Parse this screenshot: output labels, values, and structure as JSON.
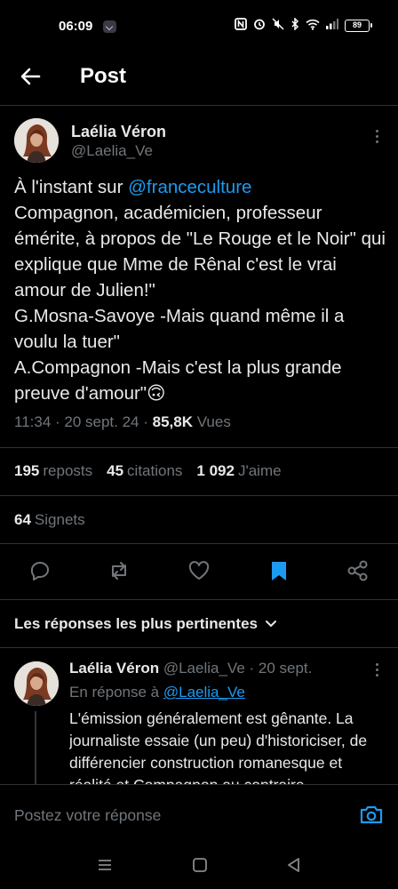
{
  "status_bar": {
    "time": "06:09",
    "battery": "89"
  },
  "header": {
    "title": "Post"
  },
  "tweet": {
    "author_name": "Laélia Véron",
    "author_handle": "@Laelia_Ve",
    "text_prefix": "À l'instant sur ",
    "mention": "@franceculture",
    "text_body": "Compagnon, académicien, professeur émérite, à propos de \"Le Rouge et le Noir\" qui explique que Mme de Rênal c'est le vrai amour de Julien!\"\nG.Mosna-Savoye -Mais quand même il a voulu la tuer\"\nA.Compagnon -Mais c'est la plus grande preuve d'amour\"🙃",
    "time_date": "11:34 · 20 sept. 24 · ",
    "views_count": "85,8K",
    "views_label": " Vues",
    "reposts_count": "195",
    "reposts_label": "reposts",
    "quotes_count": "45",
    "quotes_label": "citations",
    "likes_count": "1 092",
    "likes_label": "J'aime",
    "bookmarks_count": "64",
    "bookmarks_label": "Signets"
  },
  "actions": [
    "reply-icon",
    "repost-icon",
    "like-icon",
    "bookmark-icon",
    "share-icon"
  ],
  "colors": {
    "accent": "#1d9bf0",
    "muted": "#71767b",
    "text": "#e7e9ea",
    "background": "#000000"
  },
  "replies_section": {
    "sort_label": "Les réponses les plus pertinentes"
  },
  "reply": {
    "author_name": "Laélia Véron",
    "meta": " @Laelia_Ve · 20 sept.",
    "reply_to_label": "En réponse à ",
    "reply_to_handle": "@Laelia_Ve",
    "text": "L'émission  généralement est gênante. La journaliste essaie (un peu)  d'historiciser, de différencier construction romanesque et réalité et Compagnon au contraire"
  },
  "compose": {
    "placeholder": "Postez votre réponse"
  }
}
